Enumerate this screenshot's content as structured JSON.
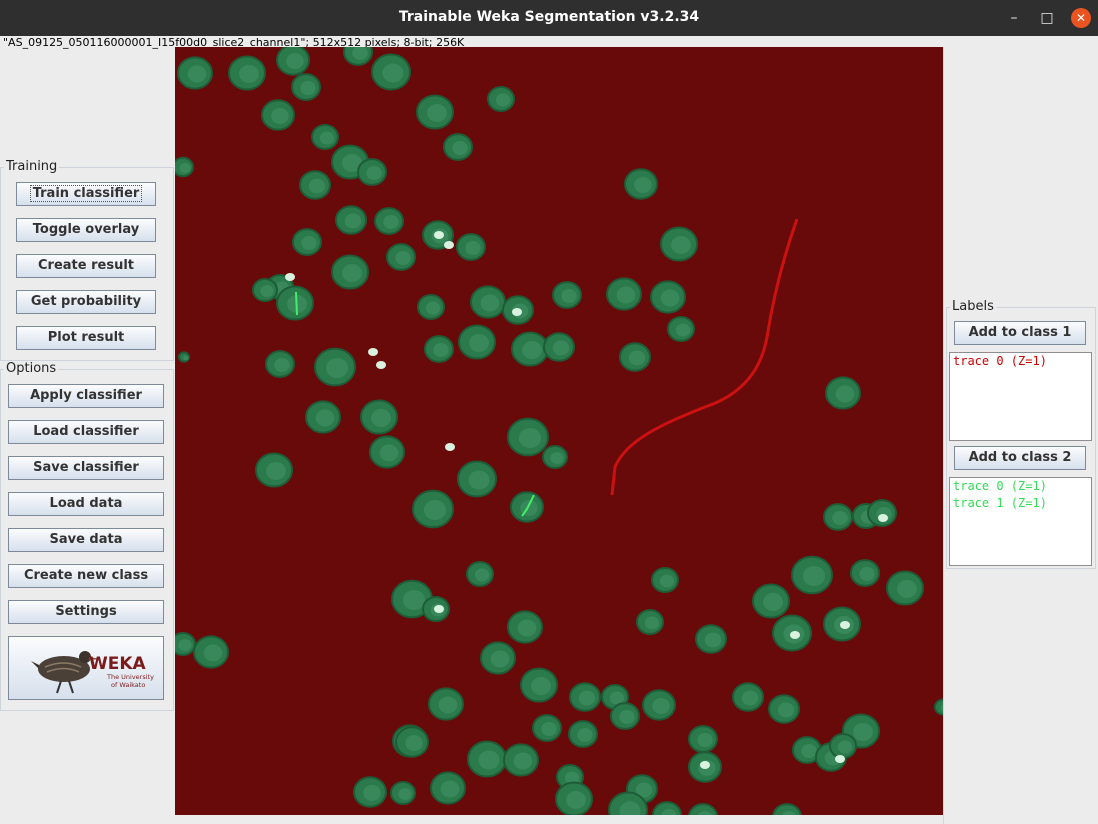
{
  "window": {
    "title": "Trainable Weka Segmentation v3.2.34",
    "controls": {
      "minimize": "–",
      "maximize": "□",
      "close": "✕"
    }
  },
  "image_info": "\"AS_09125_050116000001_I15f00d0_slice2_channel1\"; 512x512 pixels; 8-bit; 256K",
  "training": {
    "legend": "Training",
    "train_classifier": "Train classifier",
    "toggle_overlay": "Toggle overlay",
    "create_result": "Create result",
    "get_probability": "Get probability",
    "plot_result": "Plot result"
  },
  "options": {
    "legend": "Options",
    "apply_classifier": "Apply classifier",
    "load_classifier": "Load classifier",
    "save_classifier": "Save classifier",
    "load_data": "Load data",
    "save_data": "Save data",
    "create_new_class": "Create new class",
    "settings": "Settings"
  },
  "logo": {
    "text": "WEKA",
    "subtitle1": "The University",
    "subtitle2": "of Waikato"
  },
  "labels": {
    "legend": "Labels",
    "class1_button": "Add to class 1",
    "class1_traces": [
      "trace 0 (Z=1)"
    ],
    "class2_button": "Add to class 2",
    "class2_traces": [
      "trace 0 (Z=1)",
      "trace 1 (Z=1)"
    ]
  },
  "colors": {
    "overlay_background": "#680a0a",
    "cell_color": "#2e7d4f",
    "class1_color": "#cc0000",
    "class2_color": "#33dd55"
  }
}
